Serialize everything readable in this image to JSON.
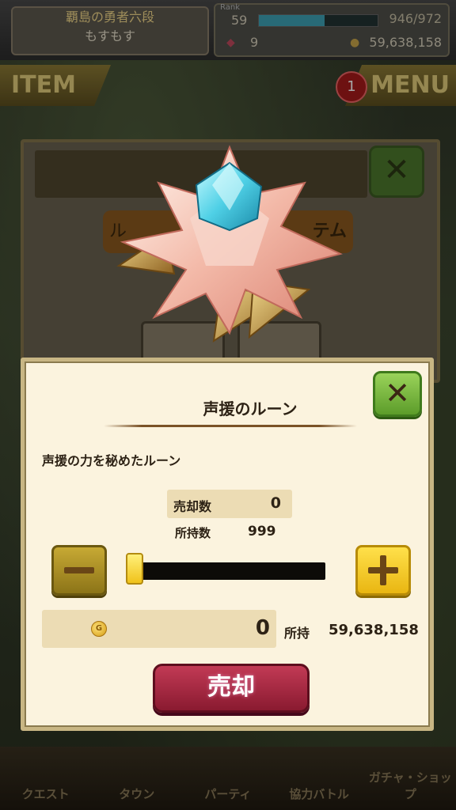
{
  "header": {
    "player_rank": "覇島の勇者六段",
    "player_name": "もすもす",
    "rank_label": "Rank",
    "level": "59",
    "stamina": "946/972",
    "gems": "9",
    "gold": "59,638,158"
  },
  "tabs": {
    "item": "ITEM",
    "menu": "MENU",
    "menu_badge": "1"
  },
  "under_dialog": {
    "button_left": "ル",
    "button_right": "テム"
  },
  "bottom_nav": {
    "items": [
      "クエスト",
      "タウン",
      "パーティ",
      "協力バトル",
      "ガチャ・ショップ"
    ]
  },
  "dialog": {
    "title": "声援のルーン",
    "description": "声援の力を秘めたルーン",
    "sell_count_label": "売却数",
    "sell_count_value": "0",
    "owned_label": "所持数",
    "owned_value": "999",
    "price_value": "0",
    "held_label": "所持",
    "held_value": "59,638,158",
    "sell_button": "売却",
    "slider_value": 0,
    "slider_max": 999
  },
  "icons": {
    "close": "close-icon",
    "coin": "coin-icon",
    "rune": "rune-icon"
  },
  "colors": {
    "close_green": "#5c9c2a",
    "sell_red": "#8a1a30",
    "plus_yellow": "#e9b612",
    "dialog_bg": "#fbf3de"
  }
}
